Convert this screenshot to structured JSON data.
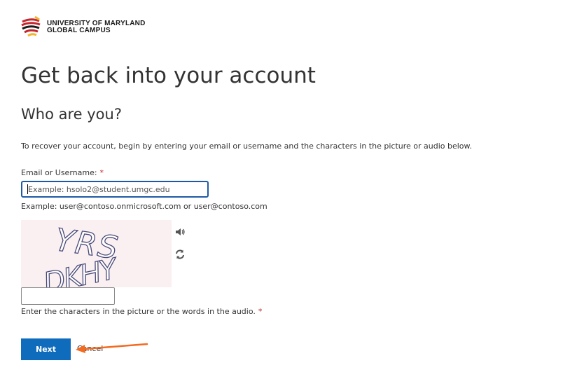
{
  "brand": {
    "line1": "UNIVERSITY OF MARYLAND",
    "line2": "GLOBAL CAMPUS",
    "colors": {
      "red": "#c4262e",
      "gold": "#f2b42c",
      "black": "#1a1a1a"
    }
  },
  "page": {
    "title": "Get back into your account",
    "subtitle": "Who are you?",
    "intro": "To recover your account, begin by entering your email or username and the characters in the picture or audio below."
  },
  "form": {
    "email_label": "Email or Username:",
    "required_mark": "*",
    "email_placeholder": "Example: hsolo2@student.umgc.edu",
    "email_value": "",
    "example_hint": "Example: user@contoso.onmicrosoft.com or user@contoso.com",
    "captcha_text": [
      "YRS",
      "DKHY"
    ],
    "captcha_audio_icon": "speaker-icon",
    "captcha_refresh_icon": "refresh-icon",
    "captcha_value": "",
    "captcha_hint": "Enter the characters in the picture or the words in the audio."
  },
  "actions": {
    "next_label": "Next",
    "cancel_label": "Cancel",
    "primary_color": "#0f6cbd"
  },
  "annotation": {
    "arrow_color": "#f26b21",
    "icon": "arrow-left-icon"
  }
}
